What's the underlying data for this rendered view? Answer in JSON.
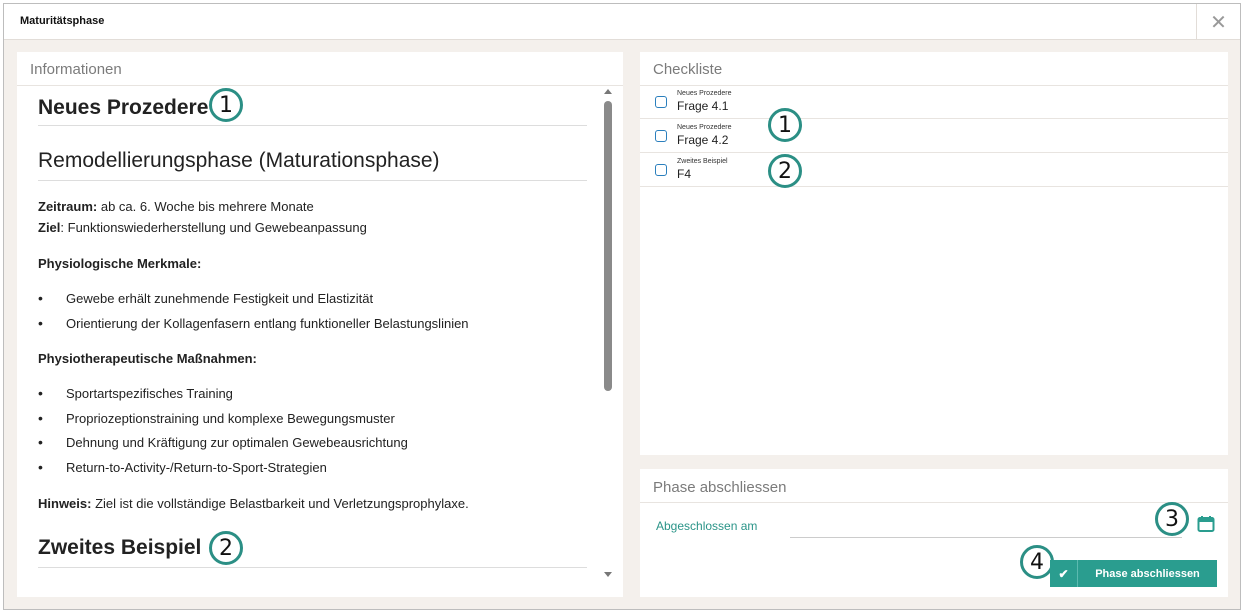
{
  "window": {
    "title": "Maturitätsphase",
    "close_symbol": "✕"
  },
  "info": {
    "header": "Informationen",
    "heading_1": "Neues Prozedere",
    "heading_2": "Remodellierungsphase (Maturationsphase)",
    "zeitraum_label": "Zeitraum:",
    "zeitraum_value": " ab ca. 6. Woche bis mehrere Monate",
    "ziel_label": "Ziel",
    "ziel_value": ": Funktionswiederherstellung und Gewebeanpassung",
    "physio_merkmale": "Physiologische Merkmale:",
    "merkmale_items": [
      "Gewebe erhält zunehmende Festigkeit und Elastizität",
      "Orientierung der Kollagenfasern entlang funktioneller Belastungslinien"
    ],
    "massnahmen": "Physiotherapeutische Maßnahmen:",
    "massnahmen_items": [
      "Sportartspezifisches Training",
      "Propriozeptionstraining und komplexe Bewegungsmuster",
      "Dehnung und Kräftigung zur optimalen Gewebeausrichtung",
      "Return-to-Activity-/Return-to-Sport-Strategien"
    ],
    "hinweis_label": "Hinweis:",
    "hinweis_value": " Ziel ist die vollständige Belastbarkeit und Verletzungsprophylaxe.",
    "heading_3": "Zweites Beispiel",
    "badge_1": "1",
    "badge_2": "2"
  },
  "checklist": {
    "header": "Checkliste",
    "items": [
      {
        "group": "Neues Prozedere",
        "label": "Frage 4.1"
      },
      {
        "group": "Neues Prozedere",
        "label": "Frage 4.2"
      },
      {
        "group": "Zweites Beispiel",
        "label": "F4"
      }
    ],
    "badge_1": "1",
    "badge_2": "2"
  },
  "phase": {
    "header": "Phase abschliessen",
    "date_label": "Abgeschlossen am",
    "button_label": "Phase abschliessen",
    "badge_3": "3",
    "badge_4": "4"
  },
  "colors": {
    "accent": "#2a9d8f",
    "badge_border": "#2b8f85",
    "checkbox_border": "#2b7fbd",
    "background": "#f4f0ec"
  }
}
